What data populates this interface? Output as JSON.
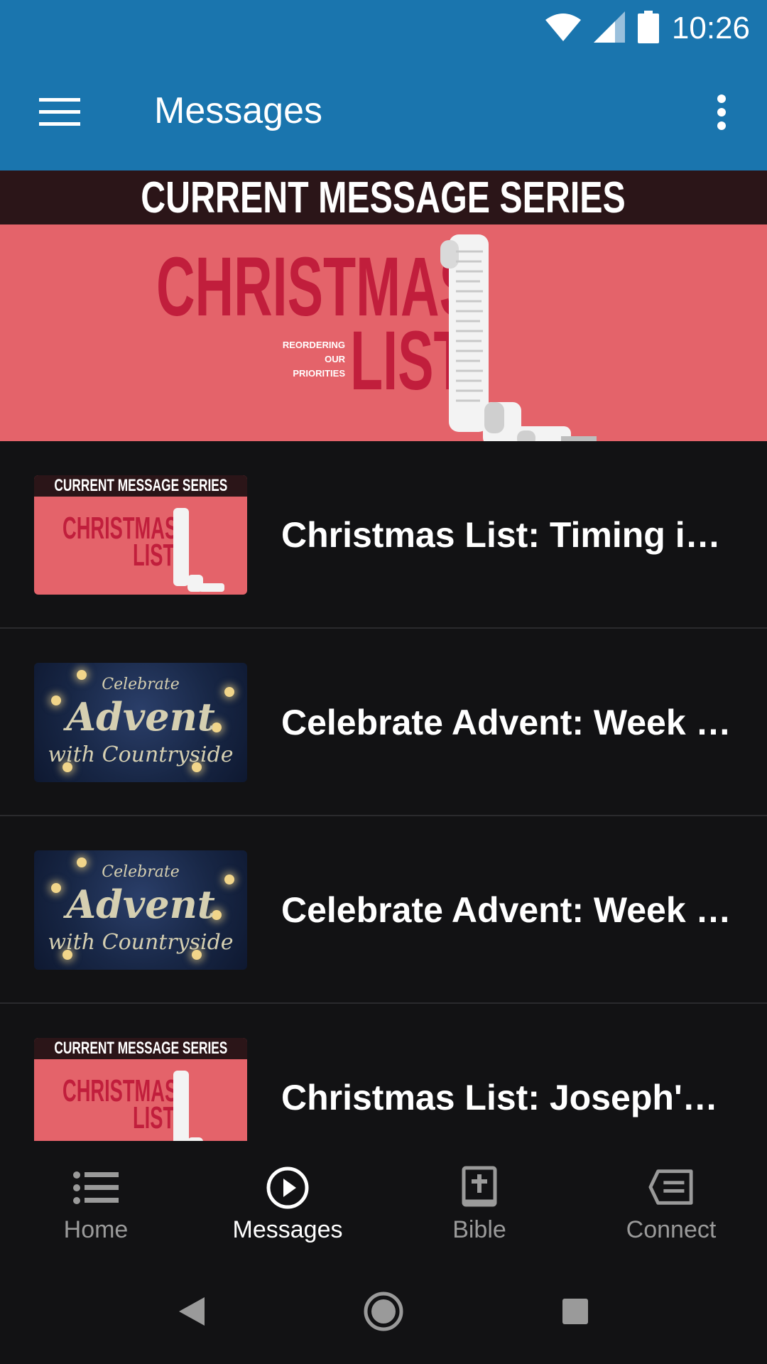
{
  "status_bar": {
    "time": "10:26",
    "icons": [
      "wifi-icon",
      "cell-signal-icon",
      "battery-icon"
    ]
  },
  "app_bar": {
    "title": "Messages",
    "menu_icon": "hamburger-menu-icon",
    "overflow_icon": "more-vert-icon"
  },
  "banner": {
    "header": "CURRENT MESSAGE SERIES",
    "title_line1": "CHRISTMAS",
    "title_line2": "LIST",
    "subtitle": [
      "REORDERING",
      "OUR",
      "PRIORITIES"
    ]
  },
  "messages": [
    {
      "title": "Christmas List: Timing is Everything",
      "thumbnail": "christmas-list"
    },
    {
      "title": "Celebrate Advent: Week Two",
      "thumbnail": "advent"
    },
    {
      "title": "Celebrate Advent: Week One",
      "thumbnail": "advent"
    },
    {
      "title": "Christmas List: Joseph's Perspective",
      "thumbnail": "christmas-list"
    }
  ],
  "thumbnails": {
    "christmas_list": {
      "header": "CURRENT MESSAGE SERIES",
      "line1": "CHRISTMAS",
      "line2": "LIST"
    },
    "advent": {
      "line1": "Celebrate",
      "line2": "Advent",
      "line3": "with Countryside"
    }
  },
  "bottom_nav": [
    {
      "label": "Home",
      "icon": "list-icon",
      "active": false
    },
    {
      "label": "Messages",
      "icon": "play-circle-icon",
      "active": true
    },
    {
      "label": "Bible",
      "icon": "bible-icon",
      "active": false
    },
    {
      "label": "Connect",
      "icon": "message-icon",
      "active": false
    }
  ],
  "system_nav": [
    "back-icon",
    "home-icon",
    "recents-icon"
  ],
  "colors": {
    "app_bar": "#1a75ae",
    "background": "#121214",
    "banner_pink": "#e4636a",
    "banner_red_text": "#c11e3c",
    "banner_strip": "#2b1518"
  }
}
